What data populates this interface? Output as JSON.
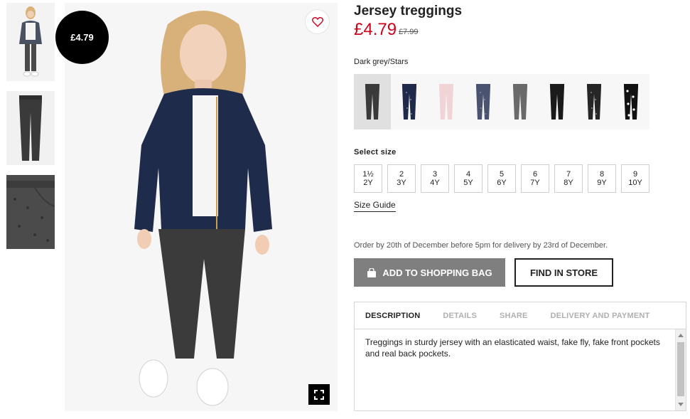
{
  "product": {
    "title": "Jersey treggings",
    "price": "£4.79",
    "old_price": "£7.99",
    "badge_price": "£4.79",
    "color_name": "Dark grey/Stars"
  },
  "swatches": [
    {
      "name": "Dark grey",
      "color": "#3a3a3a",
      "pattern": "plain",
      "active": true
    },
    {
      "name": "Navy/Stars",
      "color": "#1f2a4a",
      "pattern": "dots",
      "active": false
    },
    {
      "name": "Light pink",
      "color": "#f0d4d6",
      "pattern": "plain",
      "active": false
    },
    {
      "name": "Dark blue/Pattern",
      "color": "#4a5470",
      "pattern": "dots",
      "active": false
    },
    {
      "name": "Grey",
      "color": "#6a6a6a",
      "pattern": "plain",
      "active": false
    },
    {
      "name": "Black",
      "color": "#1a1a1a",
      "pattern": "plain",
      "active": false
    },
    {
      "name": "Black/Dots",
      "color": "#262626",
      "pattern": "dots",
      "active": false
    },
    {
      "name": "Black/Stars",
      "color": "#111111",
      "pattern": "stars",
      "active": false
    }
  ],
  "size_section": {
    "label": "Select size",
    "sizes": [
      {
        "top": "1½",
        "bottom": "2Y"
      },
      {
        "top": "2",
        "bottom": "3Y"
      },
      {
        "top": "3",
        "bottom": "4Y"
      },
      {
        "top": "4",
        "bottom": "5Y"
      },
      {
        "top": "5",
        "bottom": "6Y"
      },
      {
        "top": "6",
        "bottom": "7Y"
      },
      {
        "top": "7",
        "bottom": "8Y"
      },
      {
        "top": "8",
        "bottom": "9Y"
      },
      {
        "top": "9",
        "bottom": "10Y"
      }
    ],
    "guide_label": "Size Guide"
  },
  "delivery_note": "Order by 20th of December before 5pm for delivery by 23rd of December.",
  "buttons": {
    "add_to_bag": "ADD TO SHOPPING BAG",
    "find_in_store": "FIND IN STORE"
  },
  "tabs": [
    {
      "label": "DESCRIPTION",
      "active": true
    },
    {
      "label": "DETAILS",
      "active": false
    },
    {
      "label": "SHARE",
      "active": false
    },
    {
      "label": "DELIVERY AND PAYMENT",
      "active": false
    }
  ],
  "description": "Treggings in sturdy jersey with an elasticated waist, fake fly, fake front pockets and real back pockets.",
  "colors": {
    "sale_red": "#d0021b",
    "button_grey": "#7f7f7f",
    "badge_black": "#000000"
  },
  "icons": [
    "heart-icon",
    "fullscreen-icon",
    "bag-icon"
  ]
}
